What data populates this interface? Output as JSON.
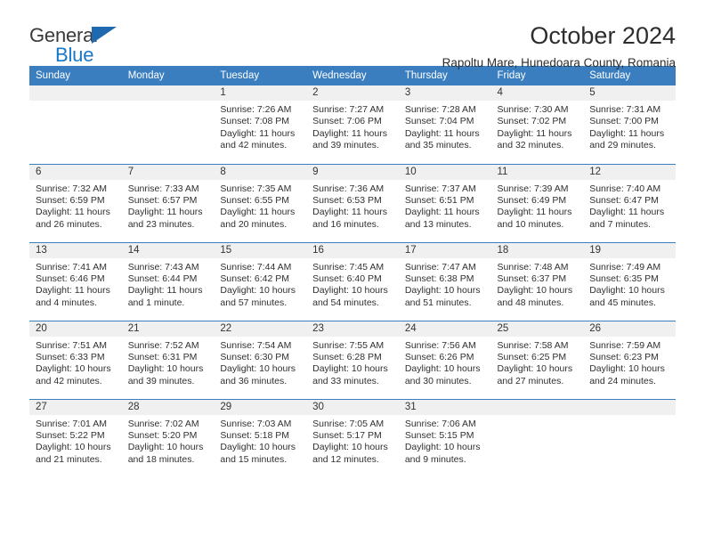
{
  "brand": {
    "word_one": "General",
    "word_two": "Blue",
    "triangle_icon": "triangle-icon",
    "accent_color": "#1878c8",
    "triangle_color": "#1f69b0"
  },
  "header": {
    "title": "October 2024",
    "subtitle": "Rapoltu Mare, Hunedoara County, Romania",
    "header_bg_color": "#3b7ebf"
  },
  "calendar": {
    "weekdays": [
      "Sunday",
      "Monday",
      "Tuesday",
      "Wednesday",
      "Thursday",
      "Friday",
      "Saturday"
    ],
    "weeks": [
      [
        {
          "day": "",
          "empty": true
        },
        {
          "day": "",
          "empty": true
        },
        {
          "day": "1",
          "sunrise": "Sunrise: 7:26 AM",
          "sunset": "Sunset: 7:08 PM",
          "daylight": "Daylight: 11 hours and 42 minutes."
        },
        {
          "day": "2",
          "sunrise": "Sunrise: 7:27 AM",
          "sunset": "Sunset: 7:06 PM",
          "daylight": "Daylight: 11 hours and 39 minutes."
        },
        {
          "day": "3",
          "sunrise": "Sunrise: 7:28 AM",
          "sunset": "Sunset: 7:04 PM",
          "daylight": "Daylight: 11 hours and 35 minutes."
        },
        {
          "day": "4",
          "sunrise": "Sunrise: 7:30 AM",
          "sunset": "Sunset: 7:02 PM",
          "daylight": "Daylight: 11 hours and 32 minutes."
        },
        {
          "day": "5",
          "sunrise": "Sunrise: 7:31 AM",
          "sunset": "Sunset: 7:00 PM",
          "daylight": "Daylight: 11 hours and 29 minutes."
        }
      ],
      [
        {
          "day": "6",
          "sunrise": "Sunrise: 7:32 AM",
          "sunset": "Sunset: 6:59 PM",
          "daylight": "Daylight: 11 hours and 26 minutes."
        },
        {
          "day": "7",
          "sunrise": "Sunrise: 7:33 AM",
          "sunset": "Sunset: 6:57 PM",
          "daylight": "Daylight: 11 hours and 23 minutes."
        },
        {
          "day": "8",
          "sunrise": "Sunrise: 7:35 AM",
          "sunset": "Sunset: 6:55 PM",
          "daylight": "Daylight: 11 hours and 20 minutes."
        },
        {
          "day": "9",
          "sunrise": "Sunrise: 7:36 AM",
          "sunset": "Sunset: 6:53 PM",
          "daylight": "Daylight: 11 hours and 16 minutes."
        },
        {
          "day": "10",
          "sunrise": "Sunrise: 7:37 AM",
          "sunset": "Sunset: 6:51 PM",
          "daylight": "Daylight: 11 hours and 13 minutes."
        },
        {
          "day": "11",
          "sunrise": "Sunrise: 7:39 AM",
          "sunset": "Sunset: 6:49 PM",
          "daylight": "Daylight: 11 hours and 10 minutes."
        },
        {
          "day": "12",
          "sunrise": "Sunrise: 7:40 AM",
          "sunset": "Sunset: 6:47 PM",
          "daylight": "Daylight: 11 hours and 7 minutes."
        }
      ],
      [
        {
          "day": "13",
          "sunrise": "Sunrise: 7:41 AM",
          "sunset": "Sunset: 6:46 PM",
          "daylight": "Daylight: 11 hours and 4 minutes."
        },
        {
          "day": "14",
          "sunrise": "Sunrise: 7:43 AM",
          "sunset": "Sunset: 6:44 PM",
          "daylight": "Daylight: 11 hours and 1 minute."
        },
        {
          "day": "15",
          "sunrise": "Sunrise: 7:44 AM",
          "sunset": "Sunset: 6:42 PM",
          "daylight": "Daylight: 10 hours and 57 minutes."
        },
        {
          "day": "16",
          "sunrise": "Sunrise: 7:45 AM",
          "sunset": "Sunset: 6:40 PM",
          "daylight": "Daylight: 10 hours and 54 minutes."
        },
        {
          "day": "17",
          "sunrise": "Sunrise: 7:47 AM",
          "sunset": "Sunset: 6:38 PM",
          "daylight": "Daylight: 10 hours and 51 minutes."
        },
        {
          "day": "18",
          "sunrise": "Sunrise: 7:48 AM",
          "sunset": "Sunset: 6:37 PM",
          "daylight": "Daylight: 10 hours and 48 minutes."
        },
        {
          "day": "19",
          "sunrise": "Sunrise: 7:49 AM",
          "sunset": "Sunset: 6:35 PM",
          "daylight": "Daylight: 10 hours and 45 minutes."
        }
      ],
      [
        {
          "day": "20",
          "sunrise": "Sunrise: 7:51 AM",
          "sunset": "Sunset: 6:33 PM",
          "daylight": "Daylight: 10 hours and 42 minutes."
        },
        {
          "day": "21",
          "sunrise": "Sunrise: 7:52 AM",
          "sunset": "Sunset: 6:31 PM",
          "daylight": "Daylight: 10 hours and 39 minutes."
        },
        {
          "day": "22",
          "sunrise": "Sunrise: 7:54 AM",
          "sunset": "Sunset: 6:30 PM",
          "daylight": "Daylight: 10 hours and 36 minutes."
        },
        {
          "day": "23",
          "sunrise": "Sunrise: 7:55 AM",
          "sunset": "Sunset: 6:28 PM",
          "daylight": "Daylight: 10 hours and 33 minutes."
        },
        {
          "day": "24",
          "sunrise": "Sunrise: 7:56 AM",
          "sunset": "Sunset: 6:26 PM",
          "daylight": "Daylight: 10 hours and 30 minutes."
        },
        {
          "day": "25",
          "sunrise": "Sunrise: 7:58 AM",
          "sunset": "Sunset: 6:25 PM",
          "daylight": "Daylight: 10 hours and 27 minutes."
        },
        {
          "day": "26",
          "sunrise": "Sunrise: 7:59 AM",
          "sunset": "Sunset: 6:23 PM",
          "daylight": "Daylight: 10 hours and 24 minutes."
        }
      ],
      [
        {
          "day": "27",
          "sunrise": "Sunrise: 7:01 AM",
          "sunset": "Sunset: 5:22 PM",
          "daylight": "Daylight: 10 hours and 21 minutes."
        },
        {
          "day": "28",
          "sunrise": "Sunrise: 7:02 AM",
          "sunset": "Sunset: 5:20 PM",
          "daylight": "Daylight: 10 hours and 18 minutes."
        },
        {
          "day": "29",
          "sunrise": "Sunrise: 7:03 AM",
          "sunset": "Sunset: 5:18 PM",
          "daylight": "Daylight: 10 hours and 15 minutes."
        },
        {
          "day": "30",
          "sunrise": "Sunrise: 7:05 AM",
          "sunset": "Sunset: 5:17 PM",
          "daylight": "Daylight: 10 hours and 12 minutes."
        },
        {
          "day": "31",
          "sunrise": "Sunrise: 7:06 AM",
          "sunset": "Sunset: 5:15 PM",
          "daylight": "Daylight: 10 hours and 9 minutes."
        },
        {
          "day": "",
          "empty": true
        },
        {
          "day": "",
          "empty": true
        }
      ]
    ]
  }
}
